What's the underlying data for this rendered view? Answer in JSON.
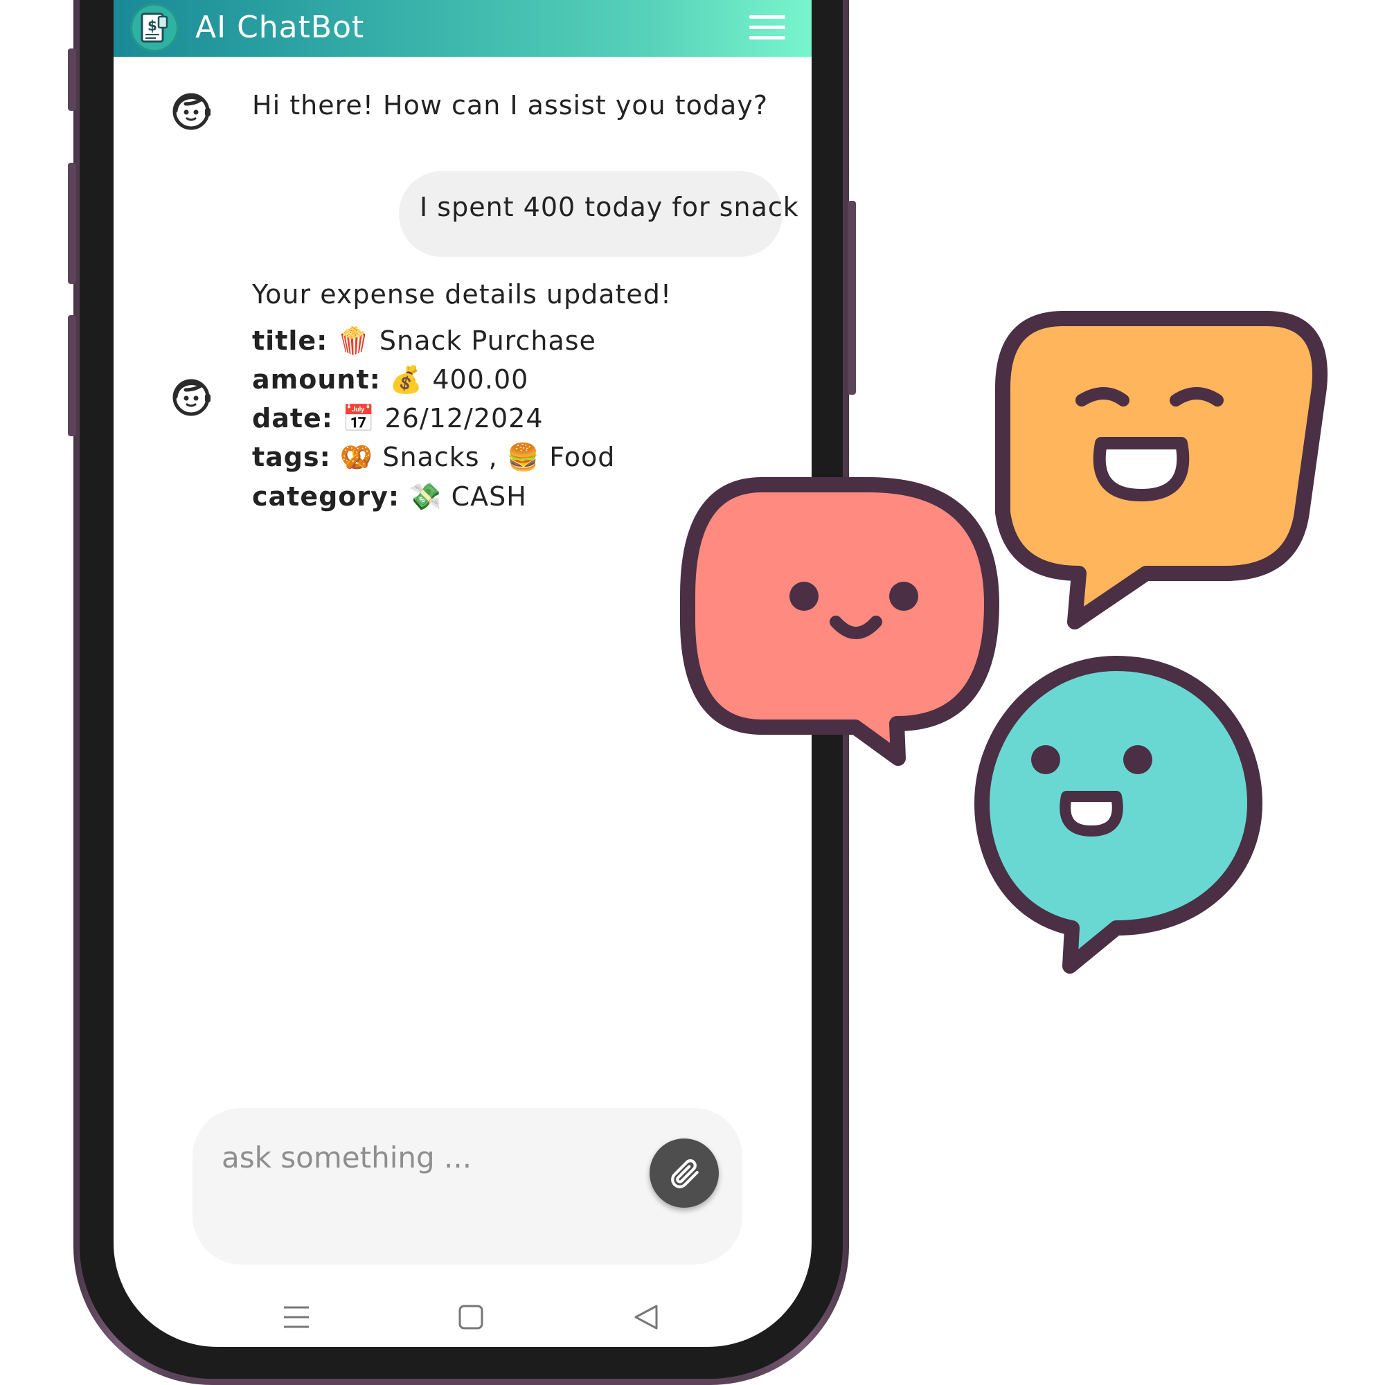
{
  "app": {
    "title": "AI ChatBot",
    "logo_icon": "receipt-dollar-icon",
    "menu_icon": "hamburger-menu-icon",
    "header_gradient": [
      "#1a8996",
      "#78f5cc"
    ]
  },
  "chat": {
    "messages": [
      {
        "sender": "bot",
        "avatar_icon": "bot-face-icon",
        "text": "Hi there! How can I assist you today?"
      },
      {
        "sender": "user",
        "text": "I spent 400 today for snack"
      },
      {
        "sender": "bot",
        "avatar_icon": "bot-face-icon",
        "text": "Your expense details updated!",
        "details": {
          "title": {
            "label": "title:",
            "emoji": "🍿",
            "value": "Snack Purchase"
          },
          "amount": {
            "label": "amount:",
            "emoji": "💰",
            "value": "400.00"
          },
          "date": {
            "label": "date:",
            "emoji": "📅",
            "value": "26/12/2024"
          },
          "tags": {
            "label": "tags:",
            "tag1_emoji": "🥨",
            "tag1": "Snacks",
            "separator": ",",
            "tag2_emoji": "🍔",
            "tag2": "Food"
          },
          "category": {
            "label": "category:",
            "emoji": "💸",
            "value": "CASH"
          }
        }
      }
    ]
  },
  "composer": {
    "placeholder": "ask something ...",
    "attach_icon": "paperclip-icon"
  },
  "system_nav": {
    "menu_icon": "recent-apps-icon",
    "home_icon": "home-square-icon",
    "back_icon": "back-triangle-icon"
  },
  "decoration": {
    "bubbles": [
      {
        "name": "orange-laughing-bubble",
        "color": "#ffb55c"
      },
      {
        "name": "red-smiling-bubble",
        "color": "#ff8a80"
      },
      {
        "name": "teal-happy-bubble",
        "color": "#6ad8d2"
      }
    ],
    "outline_color": "#4a2f45"
  }
}
